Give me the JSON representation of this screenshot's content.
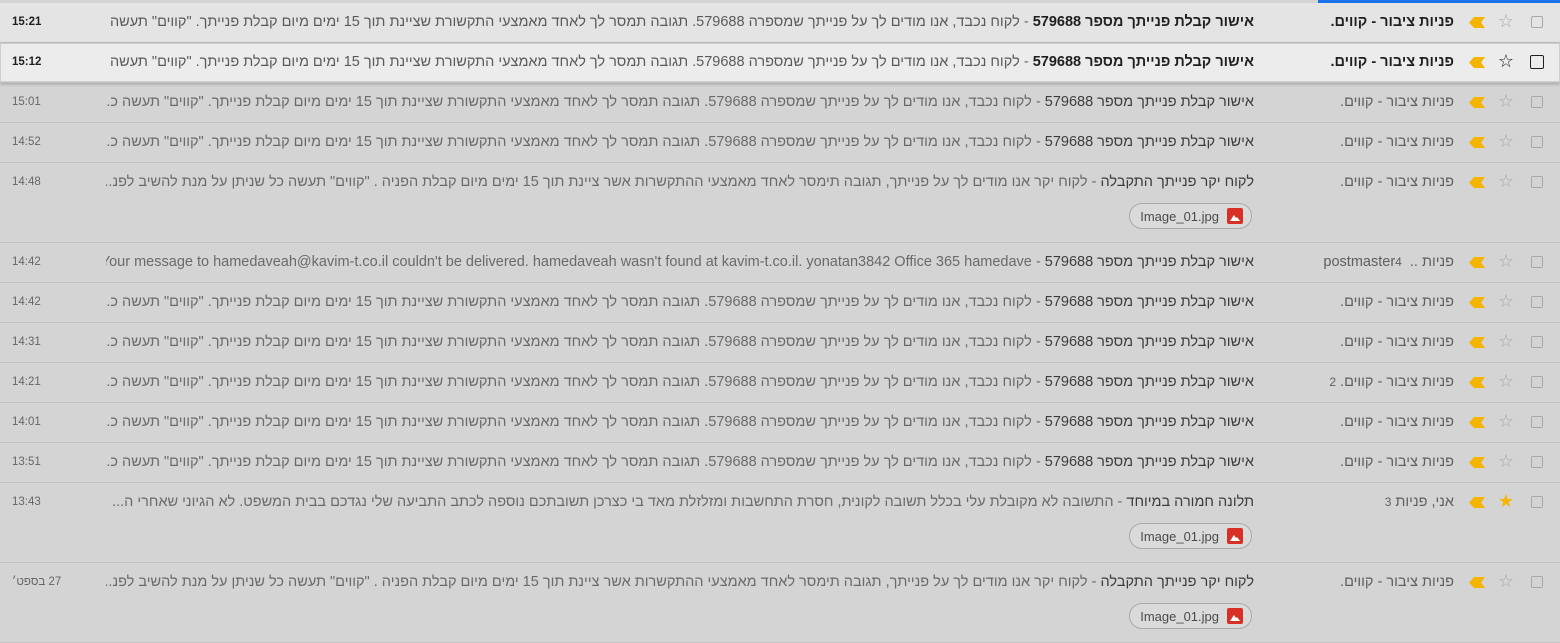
{
  "accent_color": "#1a73e8",
  "important_color": "#f4b400",
  "emails": [
    {
      "sender": "פניות ציבור - קווים.",
      "count": "",
      "subject": "אישור קבלת פנייתך מספר 579688",
      "snippet": "לקוח נכבד, אנו מודים לך על פנייתך שמספרה 579688. תגובה תמסר לך לאחד מאמצעי התקשורת שציינת תוך 15 ימים מיום קבלת פנייתך. \"קווים\" תעשה ...",
      "date": "15:21",
      "unread": true,
      "starred": false,
      "attachment": ""
    },
    {
      "sender": "פניות ציבור - קווים.",
      "count": "",
      "subject": "אישור קבלת פנייתך מספר 579688",
      "snippet": "לקוח נכבד, אנו מודים לך על פנייתך שמספרה 579688. תגובה תמסר לך לאחד מאמצעי התקשורת שציינת תוך 15 ימים מיום קבלת פנייתך. \"קווים\" תעשה ...",
      "date": "15:12",
      "unread": true,
      "starred": false,
      "hover": true,
      "attachment": ""
    },
    {
      "sender": "פניות ציבור - קווים.",
      "count": "",
      "subject": "אישור קבלת פנייתך מספר 579688",
      "snippet": "לקוח נכבד, אנו מודים לך על פנייתך שמספרה 579688. תגובה תמסר לך לאחד מאמצעי התקשורת שציינת תוך 15 ימים מיום קבלת פנייתך. \"קווים\" תעשה כ...",
      "date": "15:01",
      "unread": false,
      "starred": false,
      "attachment": ""
    },
    {
      "sender": "פניות ציבור - קווים.",
      "count": "",
      "subject": "אישור קבלת פנייתך מספר 579688",
      "snippet": "לקוח נכבד, אנו מודים לך על פנייתך שמספרה 579688. תגובה תמסר לך לאחד מאמצעי התקשורת שציינת תוך 15 ימים מיום קבלת פנייתך. \"קווים\" תעשה כ...",
      "date": "14:52",
      "unread": false,
      "starred": false,
      "attachment": ""
    },
    {
      "sender": "פניות ציבור - קווים.",
      "count": "",
      "subject": "לקוח יקר פנייתך התקבלה",
      "snippet": "לקוח יקר אנו מודים לך על פנייתך, תגובה תימסר לאחד מאמצעי ההתקשרות אשר ציינת תוך 15 ימים מיום קבלת הפניה . \"קווים\" תעשה כל שניתן על מנת להשיב לפנ...",
      "date": "14:48",
      "unread": false,
      "starred": false,
      "attachment": "Image_01.jpg"
    },
    {
      "sender": "פניות .. postmaster",
      "count": "4",
      "subject": "אישור קבלת פנייתך מספר 579688",
      "snippet": "Your message to hamedaveah@kavim-t.co.il couldn't be delivered. hamedaveah wasn't found at kavim-t.co.il. yonatan3842 Office 365 hamedave...",
      "date": "14:42",
      "unread": false,
      "starred": false,
      "attachment": ""
    },
    {
      "sender": "פניות ציבור - קווים.",
      "count": "",
      "subject": "אישור קבלת פנייתך מספר 579688",
      "snippet": "לקוח נכבד, אנו מודים לך על פנייתך שמספרה 579688. תגובה תמסר לך לאחד מאמצעי התקשורת שציינת תוך 15 ימים מיום קבלת פנייתך. \"קווים\" תעשה כ...",
      "date": "14:42",
      "unread": false,
      "starred": false,
      "attachment": ""
    },
    {
      "sender": "פניות ציבור - קווים.",
      "count": "",
      "subject": "אישור קבלת פנייתך מספר 579688",
      "snippet": "לקוח נכבד, אנו מודים לך על פנייתך שמספרה 579688. תגובה תמסר לך לאחד מאמצעי התקשורת שציינת תוך 15 ימים מיום קבלת פנייתך. \"קווים\" תעשה כ...",
      "date": "14:31",
      "unread": false,
      "starred": false,
      "attachment": ""
    },
    {
      "sender": "פניות ציבור - קווים.",
      "count": "2",
      "subject": "אישור קבלת פנייתך מספר 579688",
      "snippet": "לקוח נכבד, אנו מודים לך על פנייתך שמספרה 579688. תגובה תמסר לך לאחד מאמצעי התקשורת שציינת תוך 15 ימים מיום קבלת פנייתך. \"קווים\" תעשה כ...",
      "date": "14:21",
      "unread": false,
      "starred": false,
      "attachment": ""
    },
    {
      "sender": "פניות ציבור - קווים.",
      "count": "",
      "subject": "אישור קבלת פנייתך מספר 579688",
      "snippet": "לקוח נכבד, אנו מודים לך על פנייתך שמספרה 579688. תגובה תמסר לך לאחד מאמצעי התקשורת שציינת תוך 15 ימים מיום קבלת פנייתך. \"קווים\" תעשה כ...",
      "date": "14:01",
      "unread": false,
      "starred": false,
      "attachment": ""
    },
    {
      "sender": "פניות ציבור - קווים.",
      "count": "",
      "subject": "אישור קבלת פנייתך מספר 579688",
      "snippet": "לקוח נכבד, אנו מודים לך על פנייתך שמספרה 579688. תגובה תמסר לך לאחד מאמצעי התקשורת שציינת תוך 15 ימים מיום קבלת פנייתך. \"קווים\" תעשה כ...",
      "date": "13:51",
      "unread": false,
      "starred": false,
      "attachment": ""
    },
    {
      "sender": "אני, פניות",
      "count": "3",
      "subject": "תלונה חמורה במיוחד",
      "snippet": "התשובה לא מקובלת עלי בכלל תשובה לקונית, חסרת התחשבות ומזלזלת מאד בי כצרכן תשובתכם נוספה לכתב התביעה שלי נגדכם בבית המשפט. לא הגיוני שאחרי ה...",
      "date": "13:43",
      "unread": false,
      "starred": true,
      "attachment": "Image_01.jpg"
    },
    {
      "sender": "פניות ציבור - קווים.",
      "count": "",
      "subject": "לקוח יקר פנייתך התקבלה",
      "snippet": "לקוח יקר אנו מודים לך על פנייתך, תגובה תימסר לאחד מאמצעי ההתקשרות אשר ציינת תוך 15 ימים מיום קבלת הפניה . \"קווים\" תעשה כל שניתן על מנת להשיב לפנ...",
      "date": "27 בספט׳",
      "unread": false,
      "starred": false,
      "attachment": "Image_01.jpg"
    }
  ]
}
